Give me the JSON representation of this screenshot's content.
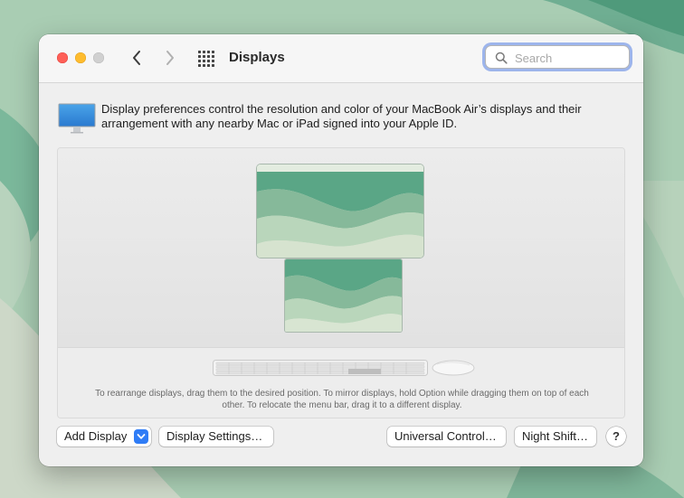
{
  "window": {
    "title": "Displays"
  },
  "toolbar": {
    "back_icon": "chevron-left",
    "forward_icon": "chevron-right",
    "grid_icon": "show-all-grid"
  },
  "search": {
    "placeholder": "Search",
    "value": ""
  },
  "description": "Display preferences control the resolution and color of your MacBook Air’s displays and their arrangement with any nearby Mac or iPad signed into your Apple ID.",
  "arrangement": {
    "hint": "To rearrange displays, drag them to the desired position. To mirror displays, hold Option while dragging them on top of each other. To relocate the menu bar, drag it to a different display."
  },
  "buttons": {
    "add_display": "Add Display",
    "display_settings": "Display Settings…",
    "universal_control": "Universal Control…",
    "night_shift": "Night Shift…",
    "help": "?"
  },
  "colors": {
    "accent": "#2f7cf6",
    "focus_ring": "#9db5ec",
    "wallpaper_dark": "#5fa488",
    "wallpaper_light": "#cfdcc8"
  }
}
